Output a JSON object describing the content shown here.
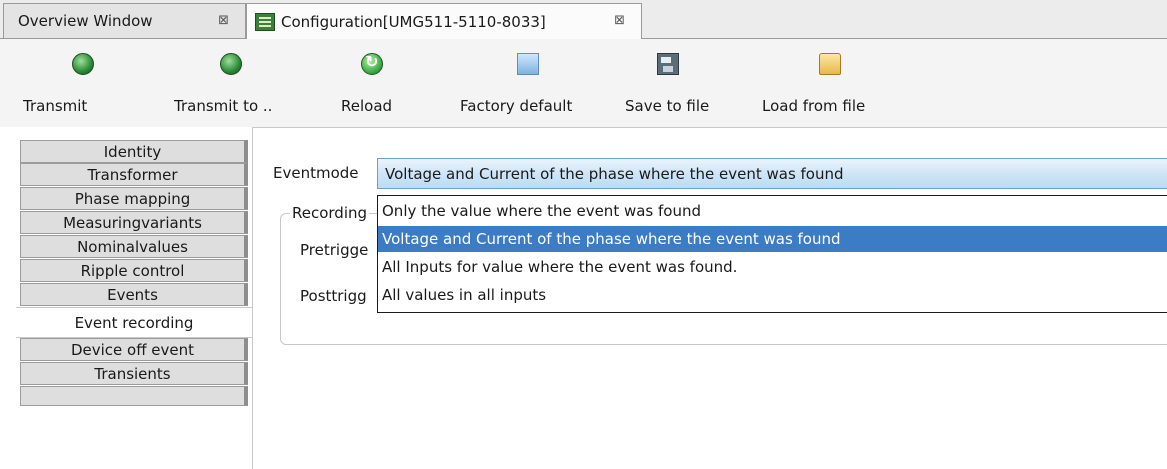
{
  "tabs": [
    {
      "label": "Overview Window",
      "close": "⊠"
    },
    {
      "label": "Configuration[UMG511-5110-8033]",
      "close": "⊠"
    }
  ],
  "toolbar": {
    "transmit": "Transmit",
    "transmit_to": "Transmit to ..",
    "reload": "Reload",
    "factory_default": "Factory default",
    "save_to_file": "Save to file",
    "load_from_file": "Load from file"
  },
  "sidebar": {
    "items": [
      "Identity",
      "Transformer",
      "Phase mapping",
      "Measuringvariants",
      "Nominalvalues",
      "Ripple control",
      "Events",
      "Event recording",
      "Device off event",
      "Transients"
    ],
    "selected": "Event recording"
  },
  "form": {
    "eventmode_label": "Eventmode",
    "eventmode_value": "Voltage and Current of the phase where the event was found",
    "recording_label": "Recording",
    "pretrigger_label": "Pretrigge",
    "posttrigger_label": "Posttrigg",
    "options": [
      "Only the value where the event was found",
      "Voltage and Current of the phase where the event was found",
      "All Inputs for value where the event was found.",
      "All values in all inputs"
    ],
    "selected_option_index": 1
  },
  "colors": {
    "selection": "#3c7cc4",
    "combo_border": "#6f9fc9"
  }
}
